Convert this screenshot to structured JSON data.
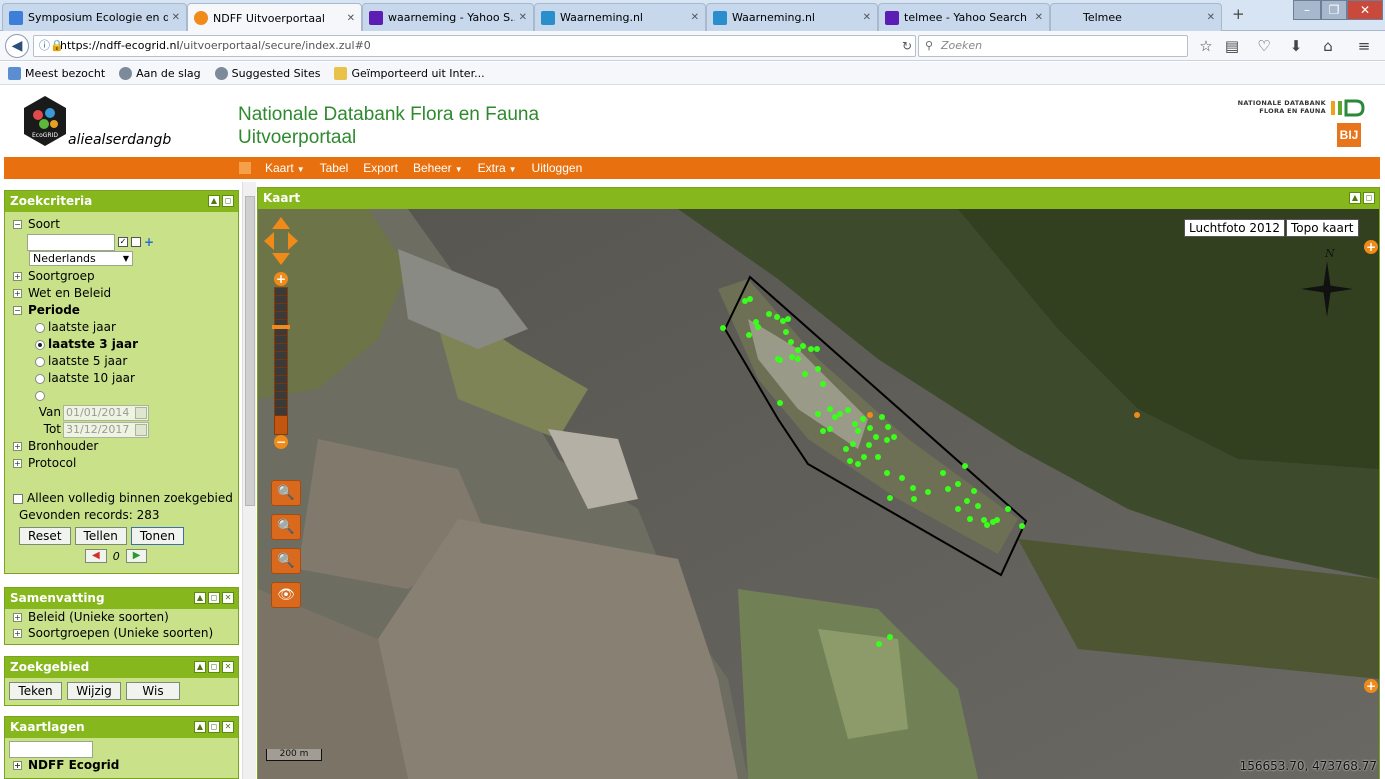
{
  "browser": {
    "tabs": [
      {
        "label": "Symposium Ecologie en de...",
        "icon_color": "#3c7ed8"
      },
      {
        "label": "NDFF Uitvoerportaal",
        "icon_color": "#f08a18"
      },
      {
        "label": "waarneming - Yahoo S...",
        "icon_color": "#5c1db5"
      },
      {
        "label": "Waarneming.nl",
        "icon_color": "#2a8dcc"
      },
      {
        "label": "Waarneming.nl",
        "icon_color": "#2a8dcc"
      },
      {
        "label": "telmee - Yahoo Search ...",
        "icon_color": "#5c1db5"
      },
      {
        "label": "Telmee",
        "icon_color": ""
      }
    ],
    "new_tab": "+",
    "url_host": "https://ndff-ecogrid.nl",
    "url_path": "/uitvoerportaal/secure/index.zul#0",
    "search_placeholder": "Zoeken",
    "bookmarks": [
      "Meest bezocht",
      "Aan de slag",
      "Suggested Sites",
      "Geïmporteerd uit Inter..."
    ]
  },
  "header": {
    "user": "aliealserdangb",
    "title_line1": "Nationale Databank Flora en Fauna",
    "title_line2": "Uitvoerportaal",
    "ndff_text_1": "NATIONALE DATABANK",
    "ndff_text_2": "FLORA EN FAUNA",
    "bij_logo": "BIJ",
    "eco_logo": "EcoGRID"
  },
  "menu": [
    "Kaart",
    "Tabel",
    "Export",
    "Beheer",
    "Extra",
    "Uitloggen"
  ],
  "zoekcriteria": {
    "title": "Zoekcriteria",
    "soort": "Soort",
    "language": "Nederlands",
    "soortgroep": "Soortgroep",
    "wet": "Wet en Beleid",
    "periode": "Periode",
    "periods": [
      "laatste jaar",
      "laatste 3 jaar",
      "laatste 5 jaar",
      "laatste 10 jaar"
    ],
    "selected_period": "laatste 3 jaar",
    "van_label": "Van",
    "van_value": "01/01/2014",
    "tot_label": "Tot",
    "tot_value": "31/12/2017",
    "bronhouder": "Bronhouder",
    "protocol": "Protocol",
    "alleen": "Alleen volledig binnen zoekgebied",
    "gevonden": "Gevonden records: 283",
    "reset": "Reset",
    "tellen": "Tellen",
    "tonen": "Tonen",
    "page": "0"
  },
  "samenvatting": {
    "title": "Samenvatting",
    "items": [
      "Beleid (Unieke soorten)",
      "Soortgroepen (Unieke soorten)"
    ]
  },
  "zoekgebied": {
    "title": "Zoekgebied",
    "teken": "Teken",
    "wijzig": "Wijzig",
    "wis": "Wis"
  },
  "kaartlagen": {
    "title": "Kaartlagen",
    "item": "NDFF Ecogrid"
  },
  "map": {
    "title": "Kaart",
    "luchtfoto": "Luchtfoto 2012",
    "topo": "Topo kaart",
    "north": "N",
    "scale": "200 m",
    "coords": "156653.70, 473768.77",
    "observation_color": "#39ff1a"
  }
}
